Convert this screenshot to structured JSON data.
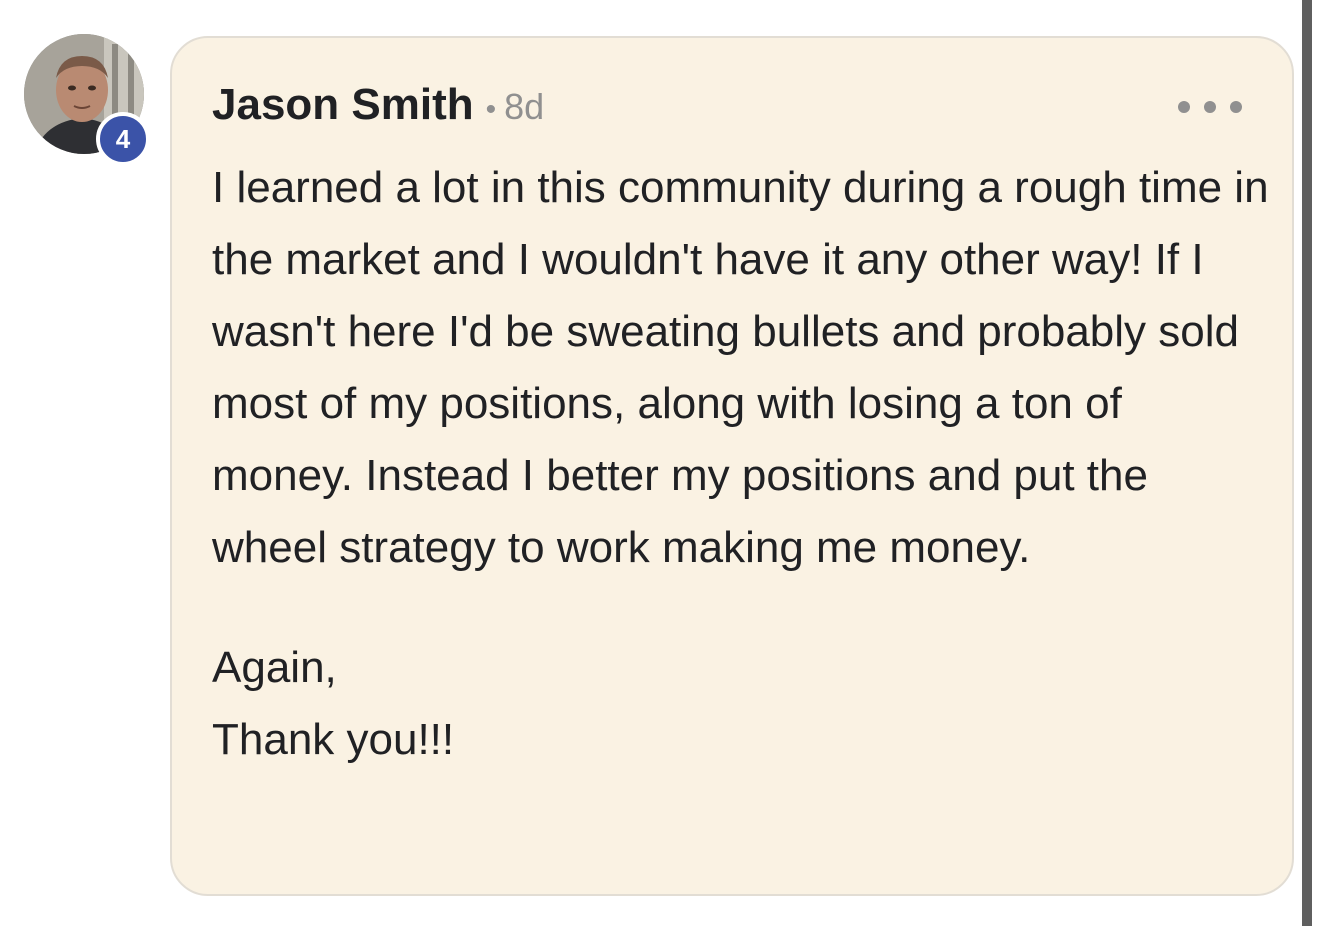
{
  "comment": {
    "author": "Jason Smith",
    "separator": "•",
    "timestamp": "8d",
    "level_badge": "4",
    "more_icon": "more-horizontal-icon",
    "paragraph_1": "I learned a lot in this community during a rough time in the market and I wouldn't have it any other way! If I wasn't here I'd be sweating bullets and probably sold most of my positions, along with losing a ton of money. Instead I better my positions and put the wheel strategy to work making me money.",
    "line_again": "Again,",
    "line_thanks": "Thank you!!!"
  },
  "colors": {
    "card_background": "#faf2e3",
    "badge": "#3b53a8",
    "text": "#202124",
    "meta_text": "#909090"
  }
}
